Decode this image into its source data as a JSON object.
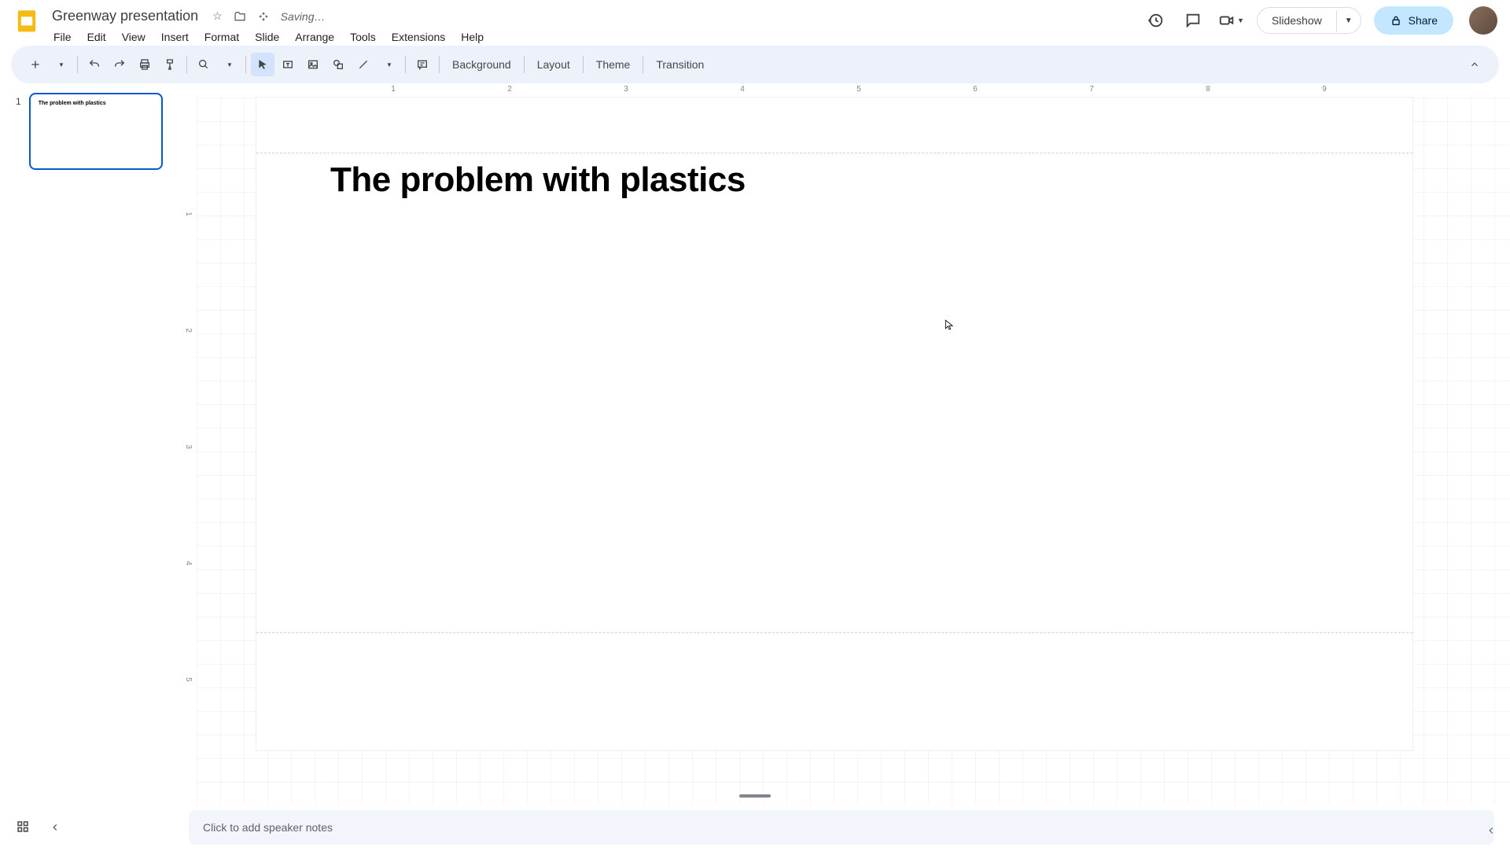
{
  "doc_title": "Greenway presentation",
  "save_status": "Saving…",
  "menu": [
    "File",
    "Edit",
    "View",
    "Insert",
    "Format",
    "Slide",
    "Arrange",
    "Tools",
    "Extensions",
    "Help"
  ],
  "toolbar": {
    "background": "Background",
    "layout": "Layout",
    "theme": "Theme",
    "transition": "Transition"
  },
  "header": {
    "slideshow": "Slideshow",
    "share": "Share"
  },
  "slide": {
    "title": "The problem with plastics"
  },
  "thumb": {
    "number": "1",
    "title": "The problem with plastics"
  },
  "notes_placeholder": "Click to add speaker notes",
  "ruler_h": [
    "1",
    "2",
    "3",
    "4",
    "5",
    "6",
    "7",
    "8",
    "9"
  ],
  "ruler_v": [
    "1",
    "2",
    "3",
    "4",
    "5"
  ]
}
